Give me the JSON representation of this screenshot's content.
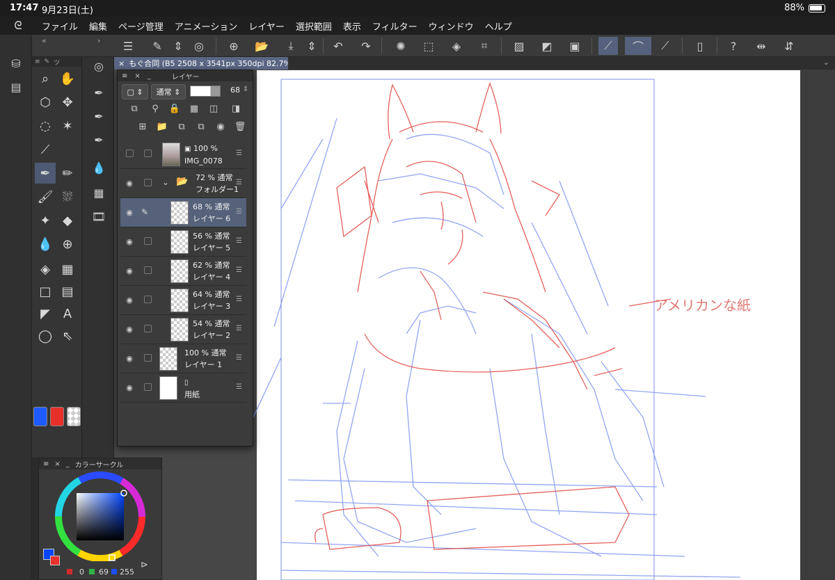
{
  "status": {
    "time": "17:47",
    "date": "9月23日(土)",
    "battery": "88%"
  },
  "menu": [
    "ファイル",
    "編集",
    "ページ管理",
    "アニメーション",
    "レイヤー",
    "選択範囲",
    "表示",
    "フィルター",
    "ウィンドウ",
    "ヘルプ"
  ],
  "document_tab": {
    "title": "もぐ合同 (B5 2508 x 3541px 350dpi 82.7%)"
  },
  "layer_panel": {
    "title": "レイヤー",
    "blend_mode": "通常",
    "opacity": "68",
    "layers": [
      {
        "name": "IMG_0078",
        "opacity": "100 %",
        "mode": "",
        "kind": "image"
      },
      {
        "name": "フォルダー1",
        "opacity": "72 %",
        "mode": "通常",
        "kind": "folder"
      },
      {
        "name": "レイヤー 6",
        "opacity": "68 %",
        "mode": "通常",
        "kind": "raster",
        "selected": true
      },
      {
        "name": "レイヤー 5",
        "opacity": "56 %",
        "mode": "通常",
        "kind": "raster"
      },
      {
        "name": "レイヤー 4",
        "opacity": "62 %",
        "mode": "通常",
        "kind": "raster"
      },
      {
        "name": "レイヤー 3",
        "opacity": "64 %",
        "mode": "通常",
        "kind": "raster"
      },
      {
        "name": "レイヤー 2",
        "opacity": "54 %",
        "mode": "通常",
        "kind": "raster"
      },
      {
        "name": "レイヤー 1",
        "opacity": "100 %",
        "mode": "通常",
        "kind": "raster"
      },
      {
        "name": "用紙",
        "opacity": "",
        "mode": "",
        "kind": "paper"
      }
    ]
  },
  "color_panel": {
    "title": "カラーサークル",
    "r": "0",
    "g": "69",
    "b": "255",
    "main_color": "#0045ff",
    "sub_color": "#e8302a"
  },
  "canvas": {
    "annotation": "アメリカンな紙"
  },
  "colors": {
    "sketch_blue": "#6f8ff0",
    "sketch_red": "#e0453f",
    "accent": "#56617a"
  }
}
